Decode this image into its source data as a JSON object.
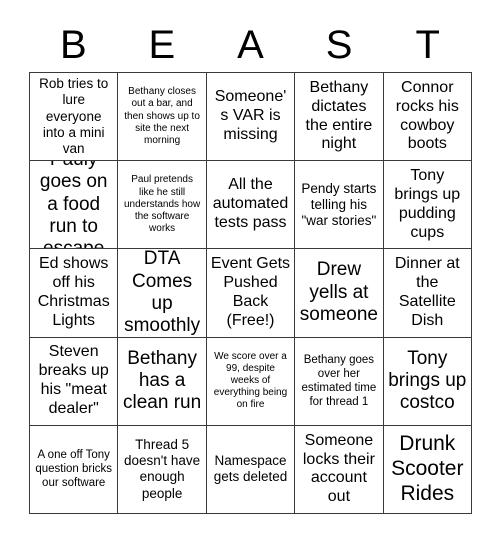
{
  "card": {
    "title": "BEAST",
    "header_letters": [
      "B",
      "E",
      "A",
      "S",
      "T"
    ],
    "border_color": "#3a3a3a",
    "text_color": "#000000",
    "background_color": "#ffffff",
    "rows": 5,
    "columns": 5,
    "cells": [
      {
        "text": "Rob tries to lure everyone into a mini van",
        "size": "md"
      },
      {
        "text": "Bethany closes out a bar, and then shows up to site the next morning",
        "size": "xs"
      },
      {
        "text": "Someone's VAR is missing",
        "size": "lg"
      },
      {
        "text": "Bethany dictates the entire night",
        "size": "lg"
      },
      {
        "text": "Connor rocks his cowboy boots",
        "size": "lg"
      },
      {
        "text": "Pauly goes on a food run to escape",
        "size": "xl"
      },
      {
        "text": "Paul pretends like he still understands how the software works",
        "size": "xs"
      },
      {
        "text": "All the automated tests pass",
        "size": "lg"
      },
      {
        "text": "Pendy starts telling his \"war stories\"",
        "size": "md"
      },
      {
        "text": "Tony brings up pudding cups",
        "size": "lg"
      },
      {
        "text": "Ed shows off his Christmas Lights",
        "size": "lg"
      },
      {
        "text": "DTA Comes up smoothly",
        "size": "xl"
      },
      {
        "text": "Event Gets Pushed Back (Free!)",
        "size": "lg"
      },
      {
        "text": "Drew yells at someone",
        "size": "xl"
      },
      {
        "text": "Dinner at the Satellite Dish",
        "size": "lg"
      },
      {
        "text": "Steven breaks up his \"meat dealer\"",
        "size": "lg"
      },
      {
        "text": "Bethany has a clean run",
        "size": "xl"
      },
      {
        "text": "We score over a 99, despite weeks of everything being on fire",
        "size": "xs"
      },
      {
        "text": "Bethany goes over her estimated time for thread 1",
        "size": "sm"
      },
      {
        "text": "Tony brings up costco",
        "size": "xl"
      },
      {
        "text": "A one off Tony question bricks our software",
        "size": "sm"
      },
      {
        "text": "Thread 5 doesn't have enough people",
        "size": "md"
      },
      {
        "text": "Namespace gets deleted",
        "size": "md"
      },
      {
        "text": "Someone locks their account out",
        "size": "lg"
      },
      {
        "text": "Drunk Scooter Rides",
        "size": "xxl"
      }
    ]
  }
}
